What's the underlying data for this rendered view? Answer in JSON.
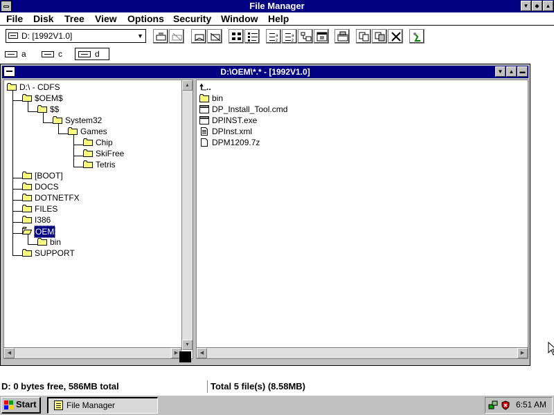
{
  "window": {
    "title": "File Manager"
  },
  "menu": [
    "File",
    "Disk",
    "Tree",
    "View",
    "Options",
    "Security",
    "Window",
    "Help"
  ],
  "toolbar": {
    "drive_selector_value": "D: [1992V1.0]"
  },
  "drives": [
    {
      "letter": "a",
      "selected": false
    },
    {
      "letter": "c",
      "selected": false
    },
    {
      "letter": "d",
      "selected": true
    }
  ],
  "child_window": {
    "title": "D:\\OEM\\*.* - [1992V1.0]"
  },
  "tree": {
    "root": "D:\\ - CDFS",
    "items": [
      "$OEM$",
      "$$",
      "System32",
      "Games",
      "Chip",
      "SkiFree",
      "Tetris",
      "[BOOT]",
      "DOCS",
      "DOTNETFX",
      "FILES",
      "I386",
      "OEM",
      "bin",
      "SUPPORT"
    ],
    "selected": "OEM"
  },
  "files": {
    "up_label": "..",
    "items": [
      {
        "name": "bin",
        "type": "folder"
      },
      {
        "name": "DP_Install_Tool.cmd",
        "type": "program"
      },
      {
        "name": "DPINST.exe",
        "type": "program"
      },
      {
        "name": "DPInst.xml",
        "type": "document"
      },
      {
        "name": "DPM1209.7z",
        "type": "file"
      }
    ]
  },
  "status": {
    "left": "D: 0 bytes free,  586MB total",
    "right": "Total 5 file(s) (8.58MB)"
  },
  "taskbar": {
    "start_label": "Start",
    "task_label": "File Manager",
    "clock": "6:51 AM"
  }
}
